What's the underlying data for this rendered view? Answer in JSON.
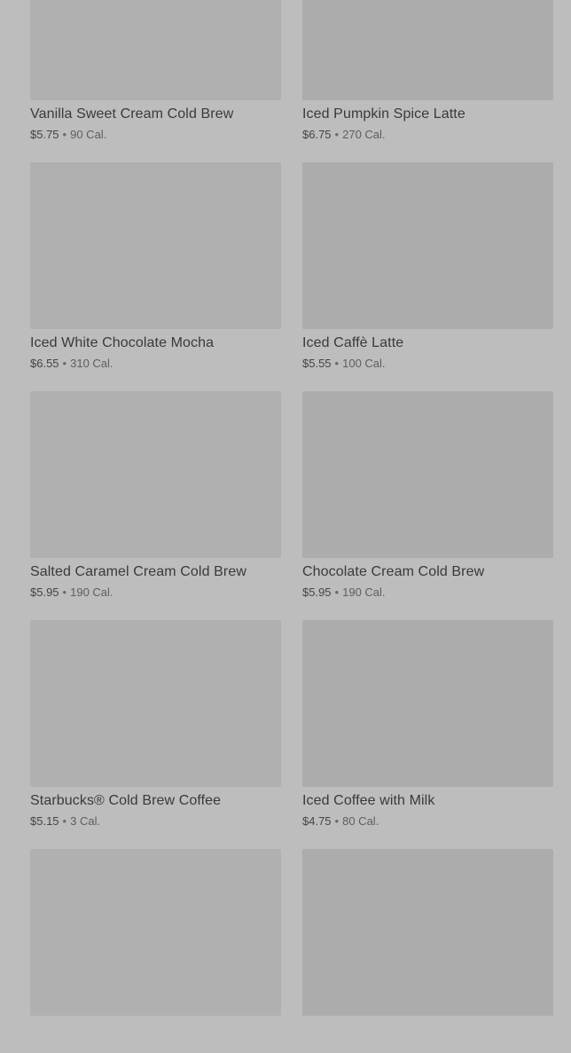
{
  "menu": {
    "items": [
      {
        "name": "Vanilla Sweet Cream Cold Brew",
        "price": "$5.75",
        "separator": "•",
        "calories": "90 Cal."
      },
      {
        "name": "Iced Pumpkin Spice Latte",
        "price": "$6.75",
        "separator": "•",
        "calories": "270 Cal."
      },
      {
        "name": "Iced White Chocolate Mocha",
        "price": "$6.55",
        "separator": "•",
        "calories": "310 Cal."
      },
      {
        "name": "Iced Caffè Latte",
        "price": "$5.55",
        "separator": "•",
        "calories": "100 Cal."
      },
      {
        "name": "Salted Caramel Cream Cold Brew",
        "price": "$5.95",
        "separator": "•",
        "calories": "190 Cal."
      },
      {
        "name": "Chocolate Cream Cold Brew",
        "price": "$5.95",
        "separator": "•",
        "calories": "190 Cal."
      },
      {
        "name": "Starbucks® Cold Brew Coffee",
        "price": "$5.15",
        "separator": "•",
        "calories": "3 Cal."
      },
      {
        "name": "Iced Coffee with Milk",
        "price": "$4.75",
        "separator": "•",
        "calories": "80 Cal."
      },
      {
        "name": "",
        "price": "",
        "separator": "",
        "calories": ""
      },
      {
        "name": "",
        "price": "",
        "separator": "",
        "calories": ""
      }
    ]
  },
  "colors": {
    "overlay_background": "#bdbdbd",
    "image_placeholder": "#b0b0b0",
    "text_primary": "#3a3a3a"
  }
}
